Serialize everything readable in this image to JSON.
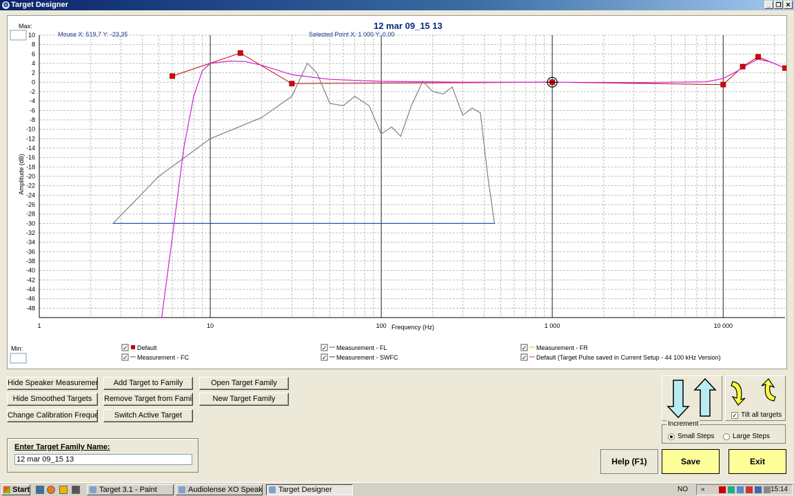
{
  "window": {
    "title": "Target Designer"
  },
  "chart": {
    "title": "12 mar 09_15 13",
    "max_label": "Max:",
    "min_label": "Min:",
    "mouse_readout": "Mouse  X: 519,7   Y: -23,35",
    "selected_readout": "Selected Point   X: 1 000   Y: 0,00"
  },
  "chart_data": {
    "type": "line",
    "xlabel": "Frequency (Hz)",
    "ylabel": "Amplitude (dB)",
    "xscale": "log",
    "xlim": [
      1,
      23000
    ],
    "ylim": [
      -50,
      10
    ],
    "grid": true,
    "x_ticks": [
      {
        "value": 1,
        "label": "1"
      },
      {
        "value": 10,
        "label": "10"
      },
      {
        "value": 100,
        "label": "100"
      },
      {
        "value": 1000,
        "label": "1 000"
      },
      {
        "value": 10000,
        "label": "10 000"
      }
    ],
    "y_ticks": [
      10,
      8,
      6,
      4,
      2,
      0,
      -2,
      -4,
      -6,
      -8,
      -10,
      -12,
      -14,
      -16,
      -18,
      -20,
      -22,
      -24,
      -26,
      -28,
      -30,
      -32,
      -34,
      -36,
      -38,
      -40,
      -42,
      -44,
      -46,
      -48
    ],
    "series": [
      {
        "name": "Default",
        "color": "#c00000",
        "style": "points",
        "points": [
          [
            6,
            1.3
          ],
          [
            15,
            6.2
          ],
          [
            30,
            -0.3
          ],
          [
            1000,
            0
          ],
          [
            10000,
            -0.5
          ],
          [
            13000,
            3.3
          ],
          [
            16000,
            5.4
          ],
          [
            23000,
            3.0
          ]
        ]
      },
      {
        "name": "Measurement - FC",
        "color": "#808080",
        "points": [
          [
            2.7,
            -30
          ],
          [
            5,
            -20
          ],
          [
            10,
            -12
          ],
          [
            20,
            -7.5
          ],
          [
            30,
            -3
          ],
          [
            37,
            4
          ],
          [
            42,
            2
          ],
          [
            50,
            -4.5
          ],
          [
            60,
            -5
          ],
          [
            70,
            -3
          ],
          [
            85,
            -5
          ],
          [
            100,
            -11
          ],
          [
            115,
            -9.5
          ],
          [
            130,
            -11.5
          ],
          [
            150,
            -5
          ],
          [
            175,
            0.2
          ],
          [
            200,
            -2
          ],
          [
            230,
            -2.5
          ],
          [
            260,
            -1
          ],
          [
            300,
            -7
          ],
          [
            340,
            -5.5
          ],
          [
            380,
            -6.5
          ],
          [
            420,
            -20
          ],
          [
            460,
            -30
          ]
        ]
      },
      {
        "name": "Measurement - SWFC",
        "color": "#1f3f9f",
        "points": [
          [
            2.7,
            -30
          ],
          [
            460,
            -30
          ]
        ]
      },
      {
        "name": "Default (Target Pulse saved in Current Setup - 44 100 kHz Version)",
        "color": "#d020d0",
        "points": [
          [
            5.2,
            -50
          ],
          [
            6,
            -33
          ],
          [
            7,
            -14
          ],
          [
            8,
            -3
          ],
          [
            9,
            2.5
          ],
          [
            10,
            4
          ],
          [
            13,
            4.5
          ],
          [
            16,
            4.4
          ],
          [
            20,
            3.6
          ],
          [
            30,
            1.6
          ],
          [
            50,
            0.6
          ],
          [
            100,
            0.2
          ],
          [
            300,
            0
          ],
          [
            1000,
            0
          ],
          [
            3000,
            -0.1
          ],
          [
            8000,
            0.1
          ],
          [
            10000,
            0.8
          ],
          [
            12000,
            2.3
          ],
          [
            14000,
            3.8
          ],
          [
            16000,
            4.9
          ],
          [
            19000,
            4.3
          ],
          [
            23000,
            3.0
          ]
        ]
      }
    ]
  },
  "legend": [
    {
      "label": "Default",
      "symbol": "square",
      "color": "#c00000"
    },
    {
      "label": "Measurement - FL",
      "symbol": "line",
      "color": "#555555"
    },
    {
      "label": "Measurement - FR",
      "symbol": "line",
      "color": "#cccc00"
    },
    {
      "label": "Measurement - FC",
      "symbol": "line",
      "color": "#555555"
    },
    {
      "label": "Measurement - SWFC",
      "symbol": "line",
      "color": "#1f3f9f"
    },
    {
      "label": "Default (Target Pulse saved in Current Setup - 44 100 kHz Version)",
      "symbol": "line",
      "color": "#d020d0"
    }
  ],
  "buttons": {
    "hide_speaker": "Hide Speaker Measurement",
    "hide_smoothed": "Hide Smoothed Targets",
    "change_calib": "Change  Calibration Frequenc",
    "add_target": "Add Target to Family",
    "remove_target": "Remove Target from Family",
    "switch_target": "Switch Active Target",
    "open_family": "Open Target Family",
    "new_family": "New Target Family",
    "help": "Help (F1)",
    "save": "Save",
    "exit": "Exit"
  },
  "family": {
    "label": "Enter Target Family Name:",
    "value": "12 mar 09_15 13"
  },
  "tilt": {
    "label": "Tilt all targets"
  },
  "increment": {
    "legend": "Increment",
    "small": "Small Steps",
    "large": "Large Steps"
  },
  "taskbar": {
    "start": "Start",
    "tasks": [
      "Target 3.1 - Paint",
      "Audiolense XO Speaker ...",
      "Target Designer"
    ],
    "lang": "NO",
    "clock": "15:14"
  },
  "colors": {
    "save_bg": "#ffff99",
    "exit_bg": "#ffff99",
    "title_text": "#0a2880"
  }
}
